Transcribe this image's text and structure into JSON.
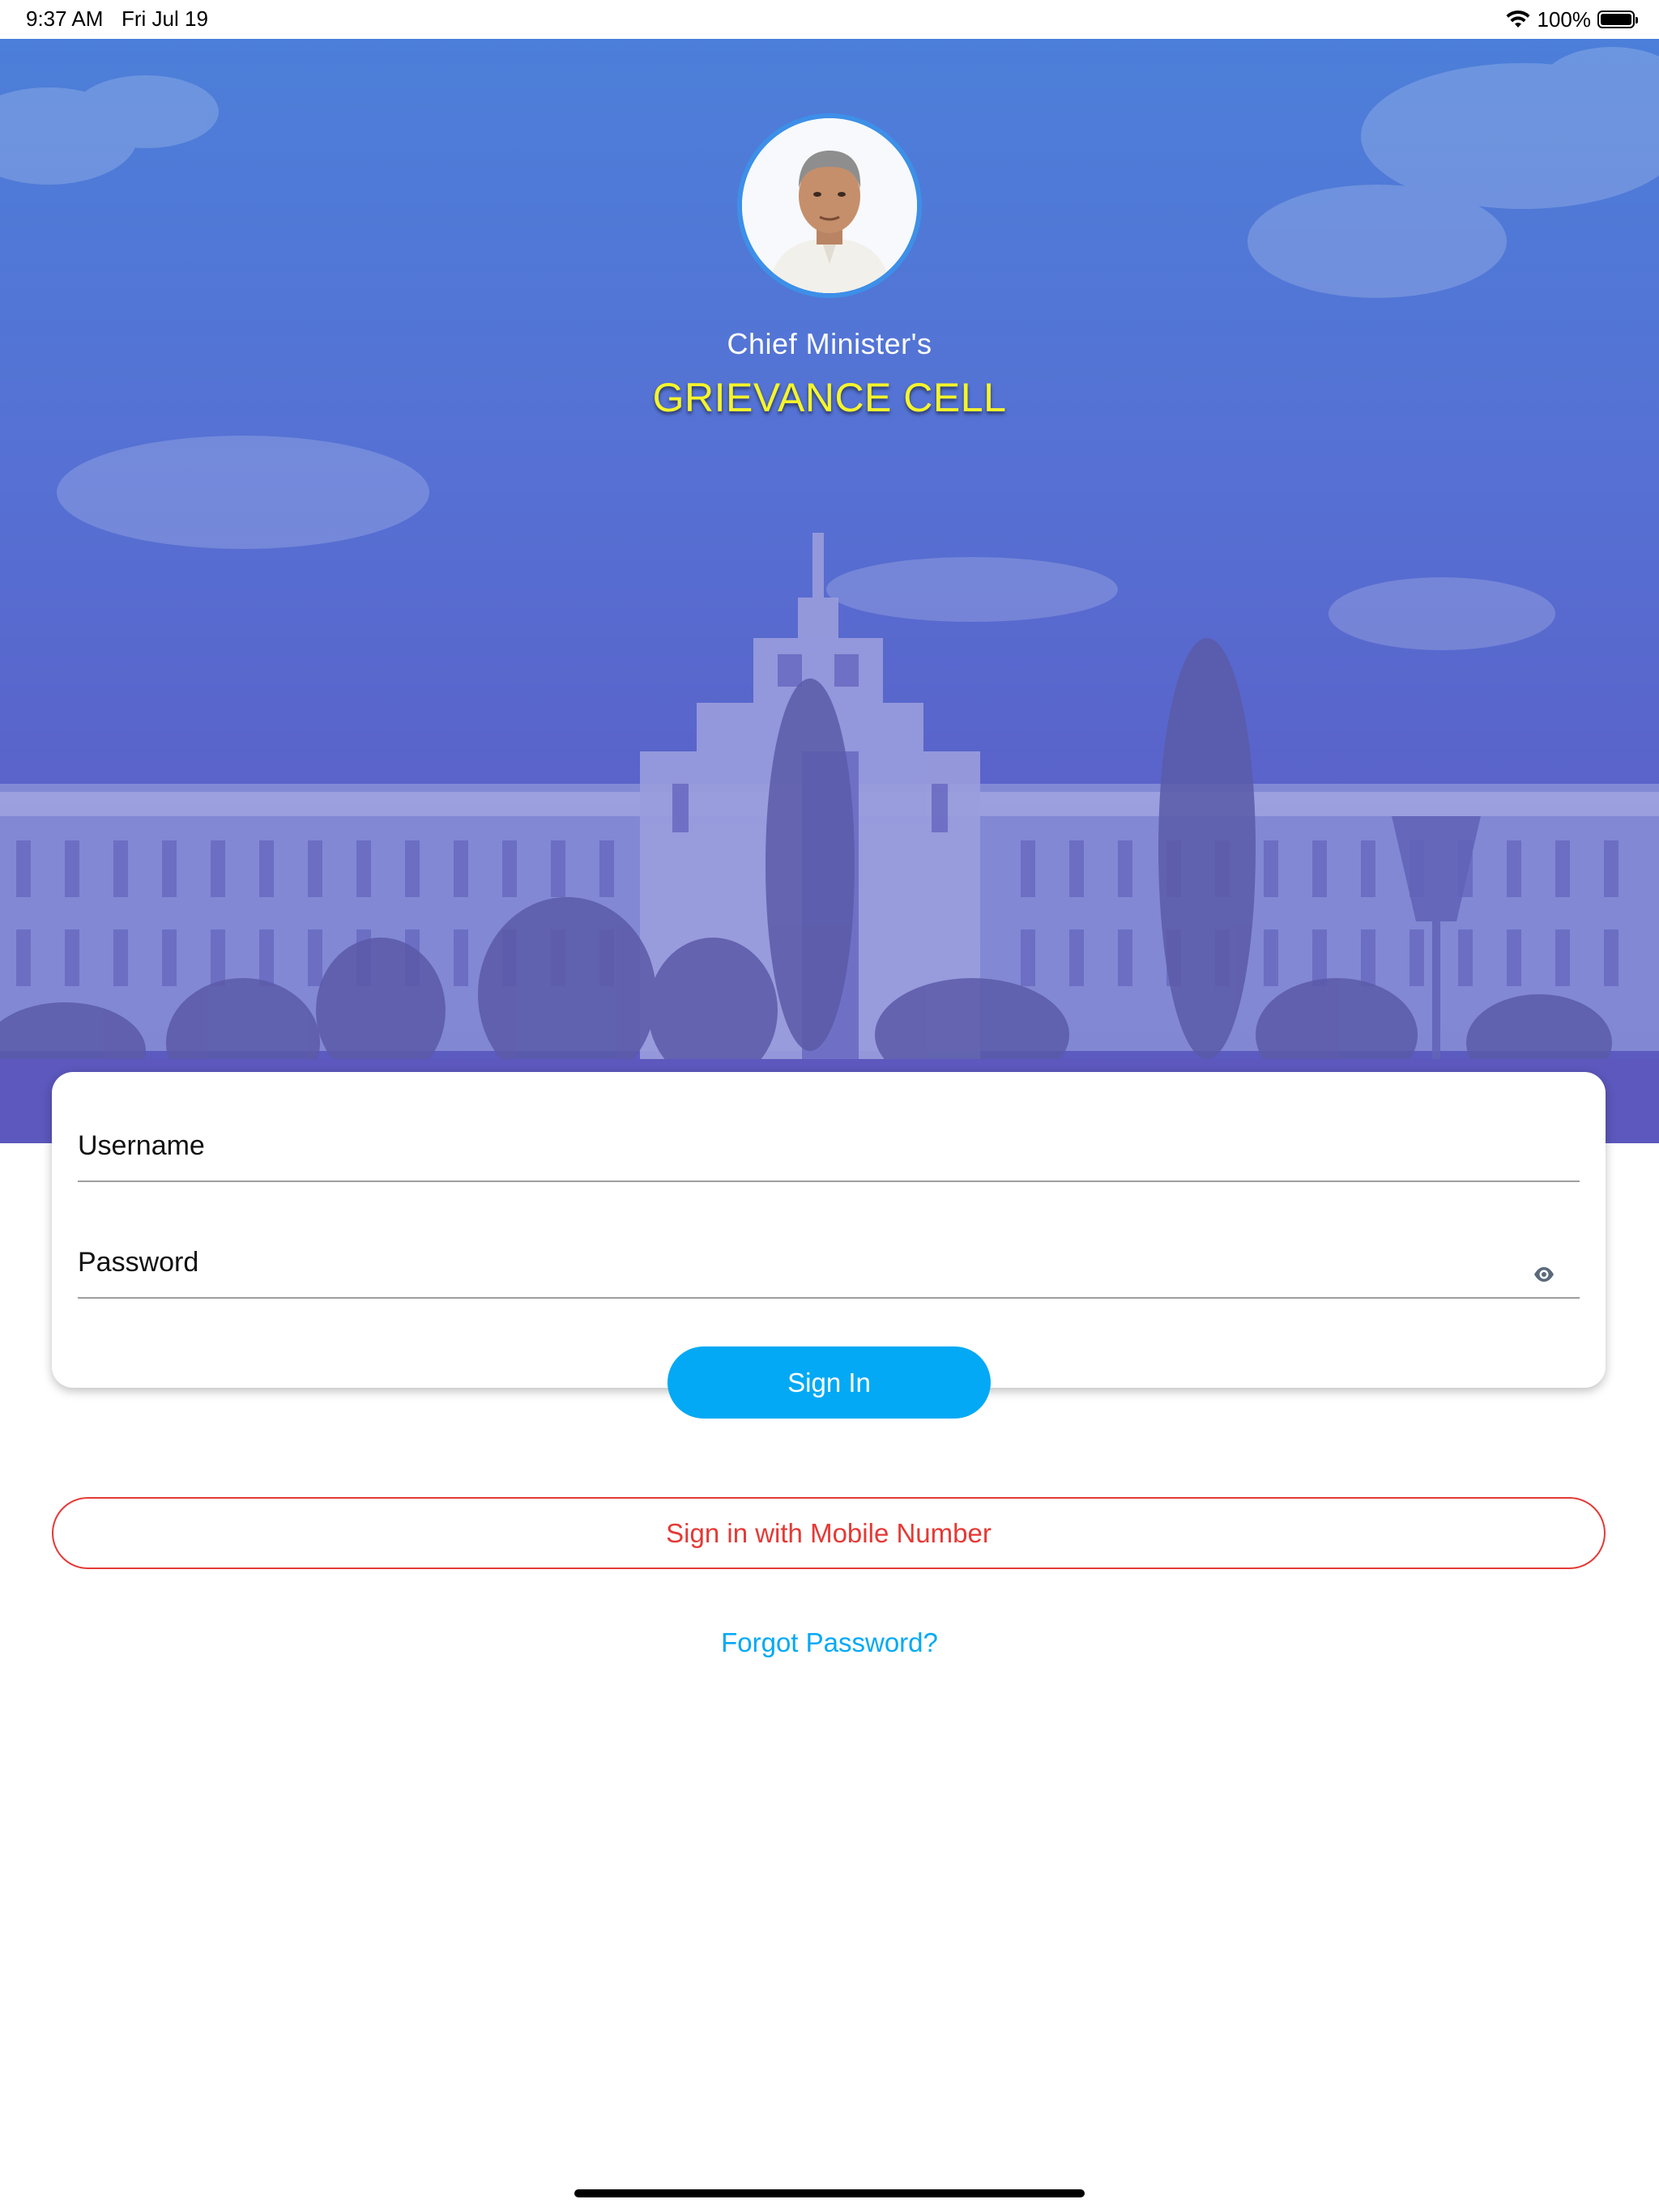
{
  "status_bar": {
    "time": "9:37 AM",
    "date": "Fri Jul 19",
    "battery_percent_label": "100%",
    "battery_level": 1.0
  },
  "header": {
    "subtitle": "Chief Minister's",
    "title": "GRIEVANCE CELL",
    "avatar_icon": "profile-photo"
  },
  "login_form": {
    "username_label": "Username",
    "password_label": "Password",
    "password_toggle_icon": "eye-icon",
    "sign_in_label": "Sign In"
  },
  "alt_login": {
    "mobile_label": "Sign in with Mobile Number",
    "forgot_label": "Forgot Password?"
  },
  "colors": {
    "primary": "#03a9f4",
    "danger": "#e53935",
    "title_yellow": "#f5f52a",
    "hero_blue": "#5670d3"
  }
}
